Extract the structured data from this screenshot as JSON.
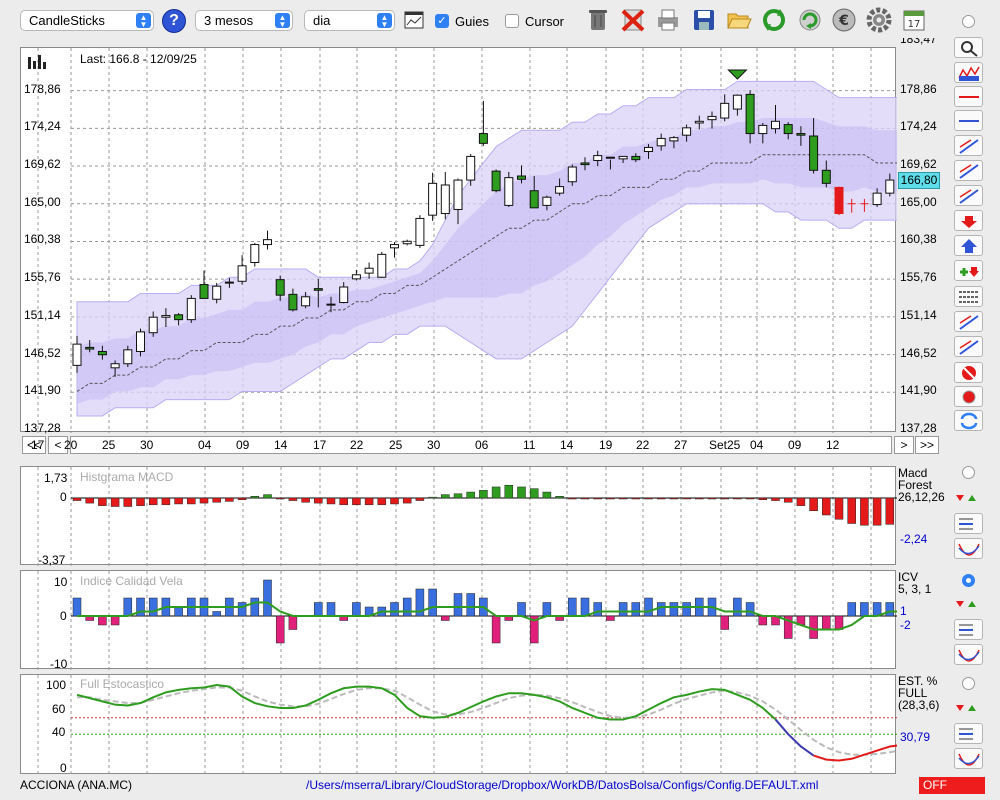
{
  "toolbar": {
    "chart_type": "CandleSticks",
    "period": "3 mesos",
    "interval": "dia",
    "guides_label": "Guies",
    "guides_checked": true,
    "cursor_label": "Cursor",
    "cursor_checked": false,
    "icons": [
      "trash-icon",
      "delete-icon",
      "print-icon",
      "save-icon",
      "open-folder-icon",
      "refresh-icon",
      "reload-icon",
      "euro-icon",
      "settings-gear-icon",
      "calendar-icon"
    ]
  },
  "main": {
    "last_label": "Last: 166.8 - 12/09/25",
    "y_labels": [
      "178,86",
      "174,24",
      "169,62",
      "165,00",
      "160,38",
      "155,76",
      "151,14",
      "146,52",
      "141,90",
      "137,28"
    ],
    "y_top_partial": "183,47",
    "current_price": "166,80",
    "price_tag_color": "#5fdde8",
    "x_labels": [
      "17",
      "20",
      "25",
      "30",
      "04",
      "09",
      "14",
      "17",
      "22",
      "25",
      "30",
      "06",
      "11",
      "14",
      "19",
      "22",
      "27",
      "Set25",
      "04",
      "09",
      "12"
    ],
    "nav": [
      "<<",
      "<",
      ">",
      ">>"
    ]
  },
  "macd": {
    "title": "Histgrama MACD",
    "y_labels": [
      "1,73",
      "0",
      "-3,37"
    ],
    "info": [
      "Macd",
      "Forest",
      "26,12,26"
    ],
    "value": "-2,24",
    "value_color": "#0000cc",
    "pos_color": "#2e9d1f",
    "neg_color": "#e41a1a"
  },
  "icv": {
    "title": "Indice Calidad Vela",
    "y_labels": [
      "10",
      "0",
      "-10"
    ],
    "info": [
      "ICV",
      "5, 3, 1"
    ],
    "value1": "1",
    "value2": "-2",
    "value_color": "#0000cc",
    "pos_color": "#3a6fe0",
    "neg_color": "#e0207a",
    "line_color": "#2e9d1f"
  },
  "stoch": {
    "title": "Full Estocastico",
    "y_labels": [
      "100",
      "60",
      "40",
      "0"
    ],
    "info": [
      "EST. %",
      "FULL",
      "(28,3,6)"
    ],
    "value": "30,79",
    "value_color": "#0000cc",
    "k_color": "#2e9d1f",
    "d_color": "#bbbbbb"
  },
  "status": {
    "ticker": "ACCIONA (ANA.MC)",
    "path": "/Users/mserra/Library/CloudStorage/Dropbox/WorkDB/DatosBolsa/Configs/Config.DEFAULT.xml",
    "off_label": "OFF",
    "off_color": "#ee1c1c"
  },
  "chart_data": {
    "type": "candlestick",
    "ylim": [
      137.28,
      183.47
    ],
    "candles": [
      [
        145.2,
        148.8,
        144.3,
        147.8
      ],
      [
        147.4,
        148.3,
        146.8,
        147.2
      ],
      [
        146.9,
        147.6,
        145.9,
        146.5
      ],
      [
        144.9,
        145.8,
        143.8,
        145.4
      ],
      [
        145.4,
        147.6,
        145.0,
        147.1
      ],
      [
        146.9,
        149.7,
        146.3,
        149.3
      ],
      [
        149.2,
        151.8,
        148.7,
        151.1
      ],
      [
        151.1,
        152.2,
        149.9,
        151.3
      ],
      [
        151.4,
        151.6,
        150.1,
        150.8
      ],
      [
        150.8,
        153.8,
        150.4,
        153.4
      ],
      [
        155.1,
        156.8,
        153.7,
        153.4
      ],
      [
        153.3,
        155.3,
        152.8,
        154.9
      ],
      [
        155.4,
        155.9,
        154.7,
        155.3
      ],
      [
        155.5,
        158.7,
        155.1,
        157.4
      ],
      [
        157.8,
        160.2,
        157.3,
        160.0
      ],
      [
        160.0,
        161.7,
        159.4,
        160.6
      ],
      [
        155.7,
        156.2,
        153.1,
        153.8
      ],
      [
        153.9,
        154.6,
        151.8,
        152.0
      ],
      [
        152.5,
        154.2,
        152.2,
        153.6
      ],
      [
        154.6,
        155.8,
        152.3,
        154.4
      ],
      [
        152.6,
        153.6,
        151.7,
        152.7
      ],
      [
        152.9,
        155.4,
        152.8,
        154.8
      ],
      [
        155.8,
        156.9,
        155.6,
        156.3
      ],
      [
        156.5,
        157.8,
        155.8,
        157.1
      ],
      [
        156.0,
        159.1,
        155.9,
        158.8
      ],
      [
        159.6,
        160.3,
        158.4,
        160.0
      ],
      [
        160.1,
        160.6,
        159.9,
        160.4
      ],
      [
        159.9,
        163.6,
        159.6,
        163.2
      ],
      [
        163.6,
        168.8,
        162.9,
        167.5
      ],
      [
        163.8,
        168.9,
        163.1,
        167.3
      ],
      [
        164.3,
        168.1,
        162.5,
        167.9
      ],
      [
        167.9,
        171.1,
        167.2,
        170.8
      ],
      [
        173.6,
        177.6,
        172.1,
        172.4
      ],
      [
        169.0,
        169.2,
        166.4,
        166.6
      ],
      [
        164.8,
        168.9,
        164.6,
        168.2
      ],
      [
        168.4,
        169.7,
        167.5,
        168.0
      ],
      [
        166.6,
        168.4,
        164.5,
        164.5
      ],
      [
        164.8,
        166.0,
        164.2,
        165.8
      ],
      [
        166.3,
        168.1,
        166.0,
        167.1
      ],
      [
        167.7,
        169.8,
        167.2,
        169.5
      ],
      [
        170.0,
        170.7,
        169.1,
        169.8
      ],
      [
        170.3,
        171.5,
        169.6,
        170.9
      ],
      [
        170.7,
        170.4,
        169.2,
        170.6
      ],
      [
        170.5,
        170.8,
        170.0,
        170.8
      ],
      [
        170.8,
        171.2,
        170.1,
        170.4
      ],
      [
        171.4,
        172.3,
        170.5,
        171.9
      ],
      [
        172.1,
        173.6,
        171.5,
        173.0
      ],
      [
        172.7,
        173.3,
        171.8,
        173.1
      ],
      [
        173.4,
        174.7,
        172.6,
        174.3
      ],
      [
        174.9,
        175.8,
        174.1,
        175.1
      ],
      [
        175.3,
        176.3,
        174.2,
        175.7
      ],
      [
        175.5,
        178.4,
        175.1,
        177.3
      ],
      [
        176.6,
        178.4,
        175.8,
        178.3
      ],
      [
        178.4,
        178.9,
        172.4,
        173.6
      ],
      [
        173.6,
        174.9,
        172.4,
        174.6
      ],
      [
        174.2,
        177.1,
        173.6,
        175.1
      ],
      [
        174.7,
        175.0,
        172.9,
        173.6
      ],
      [
        173.6,
        174.5,
        172.1,
        173.4
      ],
      [
        173.3,
        175.5,
        168.7,
        169.1
      ],
      [
        169.1,
        170.3,
        167.0,
        167.5
      ],
      [
        167.0,
        167.1,
        163.6,
        163.8
      ],
      [
        165.0,
        165.6,
        163.9,
        165.0
      ],
      [
        165.0,
        165.6,
        164.0,
        165.0
      ],
      [
        164.9,
        166.9,
        164.6,
        166.3
      ],
      [
        166.3,
        168.7,
        165.9,
        167.9
      ],
      [
        168.4,
        169.1,
        168.0,
        168.6
      ],
      [
        169.0,
        169.3,
        166.3,
        166.8
      ],
      [
        167.3,
        169.6,
        166.9,
        168.3
      ],
      [
        169.0,
        170.0,
        168.1,
        168.9
      ],
      [
        169.2,
        169.9,
        168.7,
        169.1
      ],
      [
        169.5,
        169.6,
        166.8,
        166.8
      ]
    ],
    "bb_upper": [
      153,
      153,
      153,
      153,
      153,
      154,
      154,
      154,
      154,
      155,
      155,
      155,
      156,
      156,
      157,
      157,
      157,
      157,
      157,
      156,
      156,
      156,
      156,
      156,
      156,
      157,
      157,
      158,
      160,
      163,
      166,
      168,
      170,
      172,
      173,
      174,
      174,
      174,
      174,
      175,
      175,
      176,
      176,
      177,
      177,
      178,
      178,
      178,
      179,
      179,
      179,
      179,
      180,
      180,
      180,
      180,
      180,
      180,
      180,
      179,
      178,
      178,
      178,
      178,
      178,
      178,
      178,
      178,
      178,
      178,
      178
    ],
    "bb_lower": [
      139,
      139,
      139,
      140,
      140,
      140,
      140,
      141,
      141,
      141,
      141,
      141,
      141,
      142,
      142,
      142,
      142,
      143,
      144,
      145,
      146,
      146,
      147,
      148,
      148,
      149,
      149,
      150,
      150,
      150,
      149,
      148,
      147,
      146,
      146,
      146,
      147,
      148,
      149,
      150,
      152,
      154,
      156,
      158,
      160,
      162,
      163,
      164,
      165,
      165,
      165,
      165,
      165,
      165,
      165,
      164,
      164,
      163,
      163,
      163,
      162,
      162,
      163,
      163,
      163,
      163,
      163,
      163,
      163,
      163,
      163
    ],
    "bb_mid": [
      142,
      143,
      143,
      144,
      144,
      145,
      145,
      146,
      146,
      147,
      147,
      148,
      148,
      148,
      149,
      149,
      150,
      150,
      151,
      151,
      152,
      152,
      153,
      153,
      154,
      154,
      155,
      155,
      156,
      157,
      158,
      159,
      160,
      161,
      162,
      162,
      163,
      163,
      164,
      165,
      165,
      166,
      166,
      167,
      167,
      167,
      168,
      168,
      169,
      169,
      170,
      170,
      170,
      170,
      171,
      171,
      171,
      171,
      171,
      171,
      171,
      171,
      171,
      170,
      170,
      170,
      170,
      170,
      170,
      170,
      170
    ],
    "macd_hist": [
      -0.3,
      -0.6,
      -0.9,
      -1.0,
      -1.0,
      -0.9,
      -0.8,
      -0.8,
      -0.7,
      -0.7,
      -0.6,
      -0.5,
      -0.4,
      -0.2,
      0.2,
      0.4,
      -0.1,
      -0.3,
      -0.5,
      -0.6,
      -0.7,
      -0.8,
      -0.8,
      -0.8,
      -0.8,
      -0.7,
      -0.6,
      -0.3,
      0.1,
      0.4,
      0.5,
      0.7,
      0.9,
      1.3,
      1.5,
      1.3,
      1.1,
      0.7,
      0.2,
      -0.1,
      -0.1,
      -0.1,
      -0.1,
      -0.1,
      -0.1,
      -0.1,
      -0.1,
      -0.1,
      -0.1,
      -0.1,
      -0.1,
      -0.1,
      -0.1,
      -0.1,
      -0.2,
      -0.3,
      -0.5,
      -0.9,
      -1.5,
      -2.0,
      -2.5,
      -3.0,
      -3.2,
      -3.2,
      -3.1,
      -2.9,
      -2.8,
      -2.6,
      -2.4,
      -2.3,
      -2.2
    ],
    "icv": [
      4,
      -1,
      -2,
      -2,
      4,
      4,
      4,
      4,
      2,
      4,
      4,
      1,
      4,
      3,
      4,
      8,
      -6,
      -3,
      0,
      3,
      3,
      -1,
      3,
      2,
      2,
      3,
      4,
      6,
      6,
      -1,
      5,
      5,
      4,
      -6,
      -1,
      3,
      -6,
      3,
      -1,
      4,
      4,
      3,
      -1,
      3,
      3,
      4,
      3,
      3,
      3,
      4,
      4,
      -3,
      4,
      3,
      -2,
      -2,
      -5,
      -2,
      -5,
      -3,
      -3,
      3,
      3,
      3,
      3,
      2,
      -1,
      1,
      1,
      1,
      -2
    ],
    "icv_line": [
      0,
      0,
      0,
      0,
      0,
      1,
      1,
      2,
      2,
      2,
      2,
      2,
      2,
      2,
      3,
      3,
      1,
      0,
      0,
      0,
      0,
      0,
      0,
      0,
      1,
      1,
      1,
      1,
      2,
      2,
      2,
      2,
      2,
      0,
      0,
      0,
      -1,
      0,
      0,
      0,
      0,
      1,
      1,
      1,
      1,
      1,
      2,
      2,
      2,
      2,
      2,
      1,
      1,
      1,
      0,
      0,
      -1,
      -2,
      -3,
      -3,
      -3,
      -2,
      0,
      0,
      1,
      1,
      1,
      1,
      1,
      1,
      1
    ],
    "stoch_k": [
      88,
      84,
      80,
      76,
      75,
      78,
      85,
      91,
      94,
      96,
      97,
      100,
      98,
      86,
      78,
      74,
      72,
      72,
      75,
      82,
      90,
      96,
      98,
      98,
      96,
      88,
      72,
      62,
      60,
      61,
      66,
      73,
      80,
      86,
      90,
      90,
      88,
      85,
      80,
      72,
      66,
      60,
      58,
      58,
      62,
      70,
      78,
      85,
      88,
      92,
      95,
      94,
      88,
      82,
      72,
      58,
      40,
      25,
      14,
      9,
      8,
      10,
      15,
      20,
      25,
      27,
      30,
      31,
      31,
      31,
      31
    ],
    "stoch_d": [
      85,
      85,
      82,
      80,
      78,
      78,
      82,
      86,
      90,
      93,
      95,
      97,
      97,
      93,
      86,
      80,
      76,
      74,
      74,
      77,
      83,
      89,
      94,
      96,
      96,
      93,
      85,
      76,
      68,
      64,
      64,
      67,
      72,
      78,
      84,
      87,
      88,
      87,
      84,
      79,
      73,
      67,
      62,
      60,
      60,
      64,
      70,
      77,
      83,
      87,
      91,
      93,
      91,
      87,
      80,
      70,
      58,
      45,
      33,
      24,
      18,
      15,
      15,
      16,
      18,
      21,
      24,
      26,
      28,
      29,
      30
    ]
  }
}
